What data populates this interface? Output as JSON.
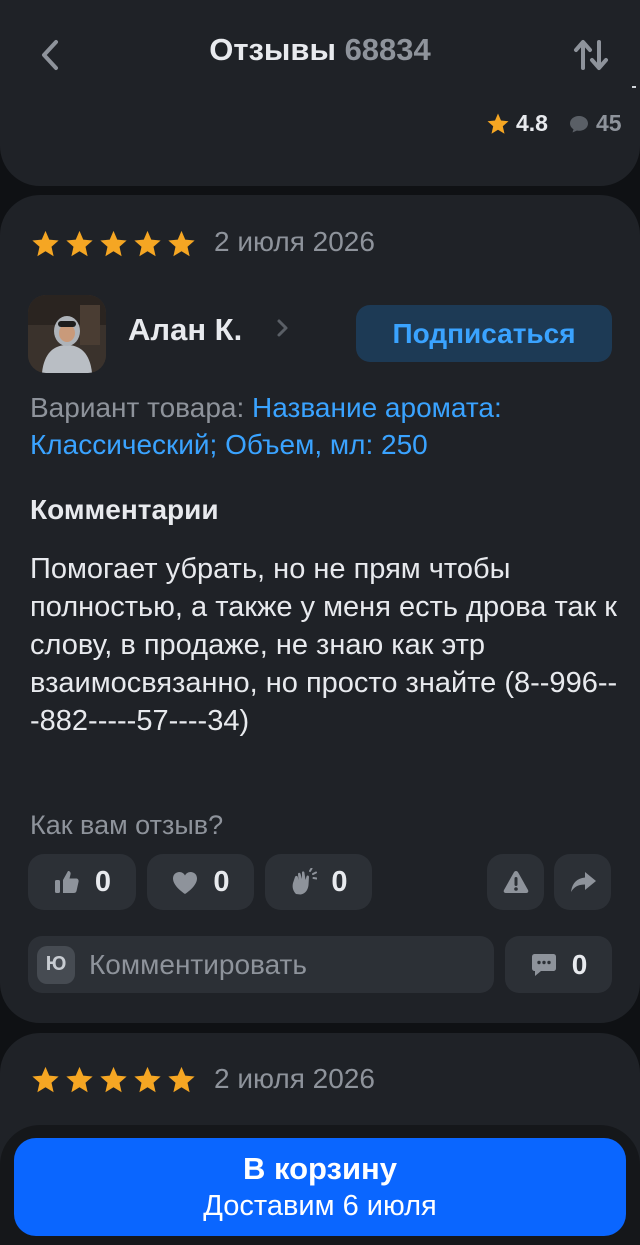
{
  "header": {
    "title": "Отзывы",
    "count": "68834",
    "rating": "4.8",
    "comments_partial": "45"
  },
  "review": {
    "date": "2 июля 2026",
    "stars": 5,
    "author": "Алан К.",
    "subscribe_label": "Подписаться",
    "variant_label": "Вариант товара:",
    "variant_value": "Название аромата: Классический; Объем, мл: 250",
    "comments_heading": "Комментарии",
    "body": "Помогает убрать, но не прям чтобы полностью, а также у меня есть дрова так к слову, в продаже, не знаю как этр взаимосвязанно, но просто знайте (8--996---882-----57----34)",
    "question": "Как вам отзыв?",
    "likes": "0",
    "hearts": "0",
    "claps": "0",
    "comment_placeholder": "Комментировать",
    "comment_badge": "Ю",
    "comment_count": "0"
  },
  "review2": {
    "date": "2 июля 2026",
    "stars": 5
  },
  "cart": {
    "label": "В корзину",
    "delivery": "Доставим 6 июля"
  },
  "colors": {
    "star": "#f5a623",
    "accent": "#3aa3ff",
    "primary_button": "#0a66ff"
  }
}
